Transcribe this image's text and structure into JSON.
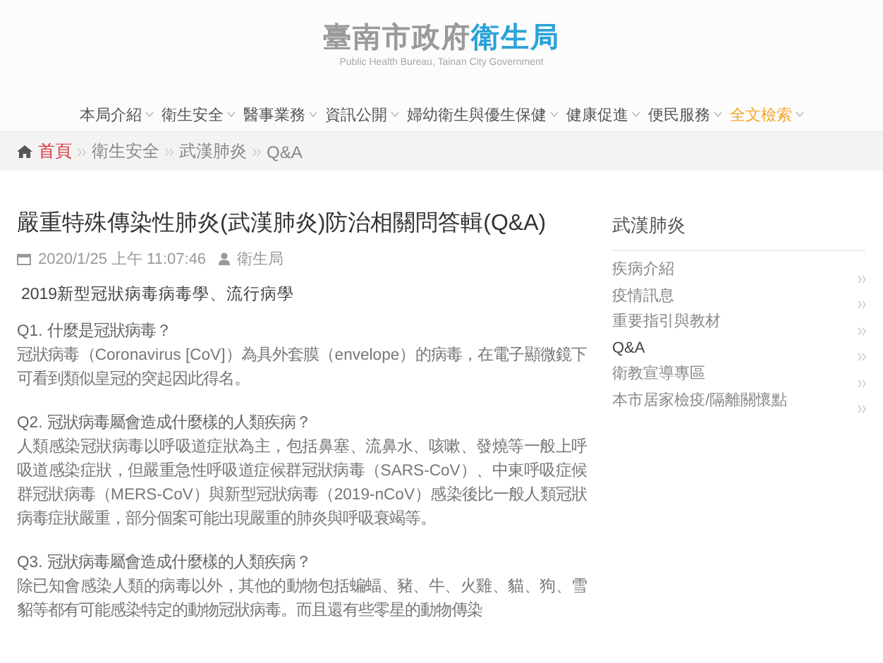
{
  "header": {
    "title_main": "臺南市政府",
    "title_accent": "衛生局",
    "subtitle": "Public Health Bureau, Tainan City Government"
  },
  "nav": [
    {
      "label": "本局介紹",
      "highlighted": false
    },
    {
      "label": "衛生安全",
      "highlighted": false
    },
    {
      "label": "醫事業務",
      "highlighted": false
    },
    {
      "label": "資訊公開",
      "highlighted": false
    },
    {
      "label": "婦幼衛生與優生保健",
      "highlighted": false
    },
    {
      "label": "健康促進",
      "highlighted": false
    },
    {
      "label": "便民服務",
      "highlighted": false
    },
    {
      "label": "全文檢索",
      "highlighted": true
    }
  ],
  "breadcrumb": [
    {
      "label": "首頁",
      "kind": "home"
    },
    {
      "label": "衛生安全",
      "kind": "link"
    },
    {
      "label": "武漢肺炎",
      "kind": "link"
    },
    {
      "label": "Q&A",
      "kind": "current"
    }
  ],
  "article": {
    "title": "嚴重特殊傳染性肺炎(武漢肺炎)防治相關問答輯(Q&A)",
    "date": "2020/1/25 上午 11:07:46",
    "author": "衛生局",
    "section": "2019新型冠狀病毒病毒學、流行病學",
    "qa": [
      {
        "question": "Q1. 什麼是冠狀病毒？",
        "answer": "冠狀病毒（Coronavirus [CoV]）為具外套膜（envelope）的病毒，在電子顯微鏡下可看到類似皇冠的突起因此得名。"
      },
      {
        "question": "Q2. 冠狀病毒屬會造成什麼樣的人類疾病？",
        "answer": "人類感染冠狀病毒以呼吸道症狀為主，包括鼻塞、流鼻水、咳嗽、發燒等一般上呼吸道感染症狀，但嚴重急性呼吸道症候群冠狀病毒（SARS-CoV）、中東呼吸症候群冠狀病毒（MERS-CoV）與新型冠狀病毒（2019-nCoV）感染後比一般人類冠狀病毒症狀嚴重，部分個案可能出現嚴重的肺炎與呼吸衰竭等。"
      },
      {
        "question": "Q3. 冠狀病毒屬會造成什麼樣的人類疾病？",
        "answer": "除已知會感染人類的病毒以外，其他的動物包括蝙蝠、豬、牛、火雞、貓、狗、雪貂等都有可能感染特定的動物冠狀病毒。而且還有些零星的動物傳染"
      }
    ]
  },
  "sidebar": {
    "title": "武漢肺炎",
    "items": [
      {
        "label": "疾病介紹",
        "selected": false
      },
      {
        "label": "疫情訊息",
        "selected": false
      },
      {
        "label": "重要指引與教材",
        "selected": false
      },
      {
        "label": "Q&A",
        "selected": true
      },
      {
        "label": "衛教宣導專區",
        "selected": false
      },
      {
        "label": "本市居家檢疫/隔離關懷點",
        "selected": false
      }
    ]
  }
}
